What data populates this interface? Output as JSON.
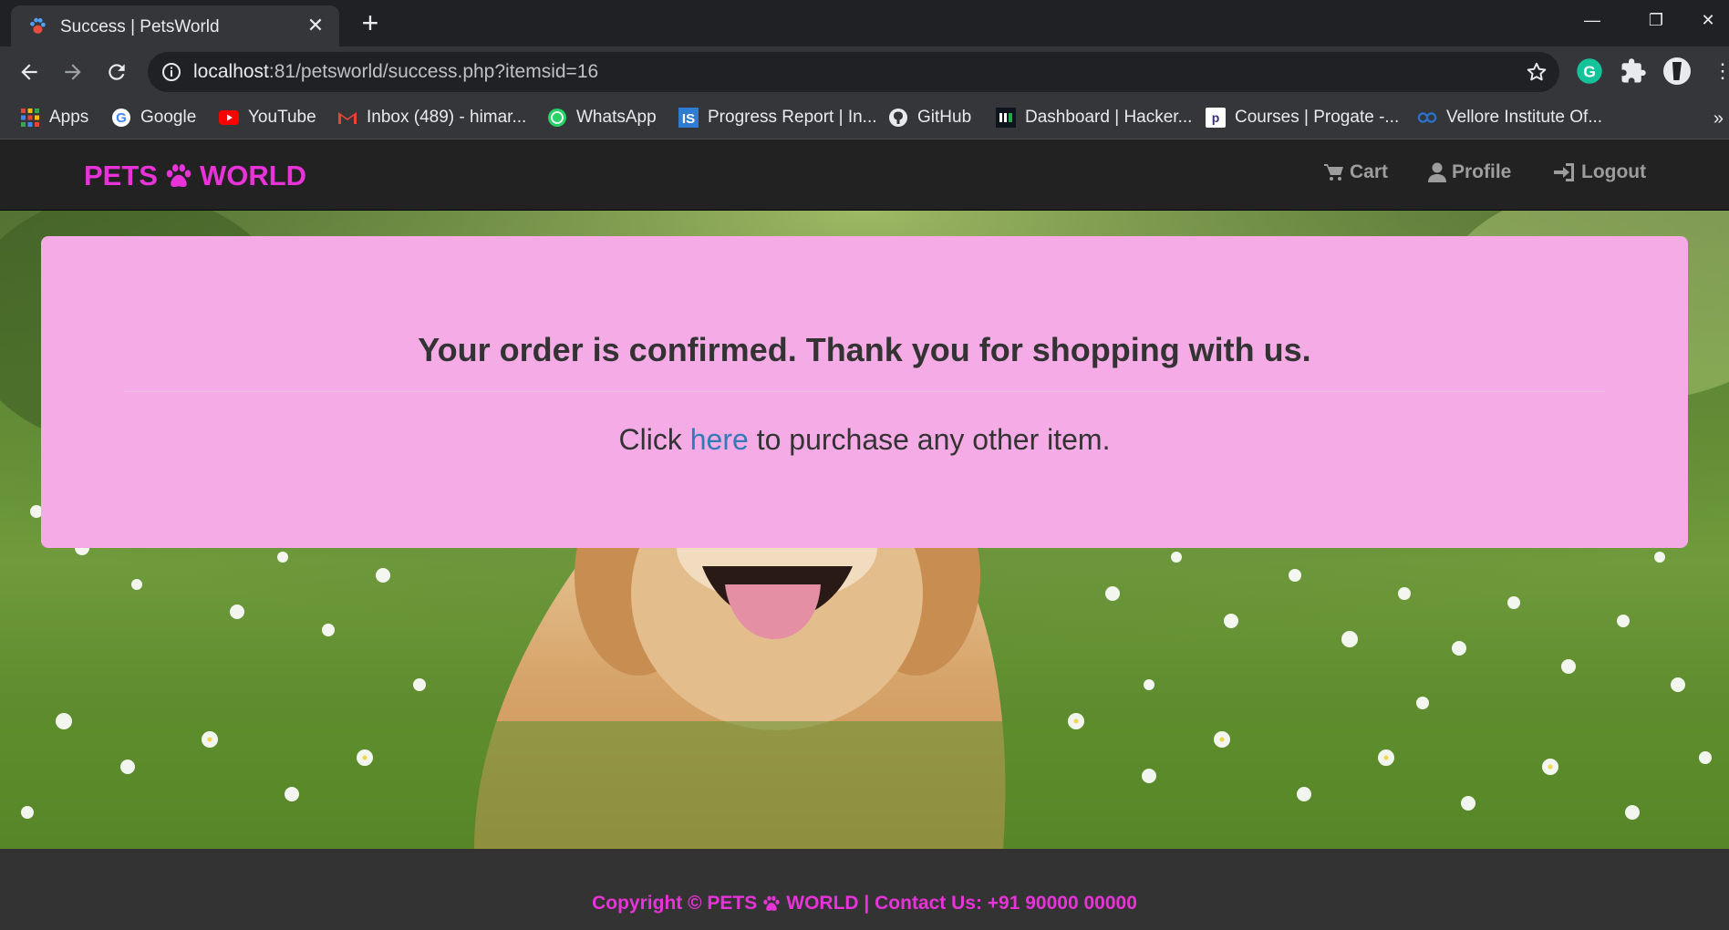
{
  "browser": {
    "tab_title": "Success | PetsWorld",
    "url_host": "localhost",
    "url_path": ":81/petsworld/success.php?itemsid=16",
    "bookmarks": [
      {
        "label": "Apps",
        "icon": "apps-grid-icon"
      },
      {
        "label": "Google",
        "icon": "google-icon"
      },
      {
        "label": "YouTube",
        "icon": "youtube-icon"
      },
      {
        "label": "Inbox (489) - himar...",
        "icon": "gmail-icon"
      },
      {
        "label": "WhatsApp",
        "icon": "whatsapp-icon"
      },
      {
        "label": "Progress Report | In...",
        "icon": "is-icon"
      },
      {
        "label": "GitHub",
        "icon": "github-icon"
      },
      {
        "label": "Dashboard | Hacker...",
        "icon": "hackerrank-icon"
      },
      {
        "label": "Courses | Progate -...",
        "icon": "progate-icon"
      },
      {
        "label": "Vellore Institute Of...",
        "icon": "coursera-icon"
      }
    ],
    "more_bookmarks": "»"
  },
  "site": {
    "brand_left": "PETS",
    "brand_right": "WORLD",
    "brand_color": "#e833d8",
    "nav": {
      "cart": "Cart",
      "profile": "Profile",
      "logout": "Logout"
    }
  },
  "jumbotron": {
    "heading": "Your order is confirmed. Thank you for shopping with us.",
    "text_before": "Click ",
    "link_text": "here",
    "text_after": " to purchase any other item.",
    "background": "#f4abe6"
  },
  "footer": {
    "prefix": "Copyright © PETS",
    "suffix": "WORLD | Contact Us: +91 90000 00000"
  }
}
